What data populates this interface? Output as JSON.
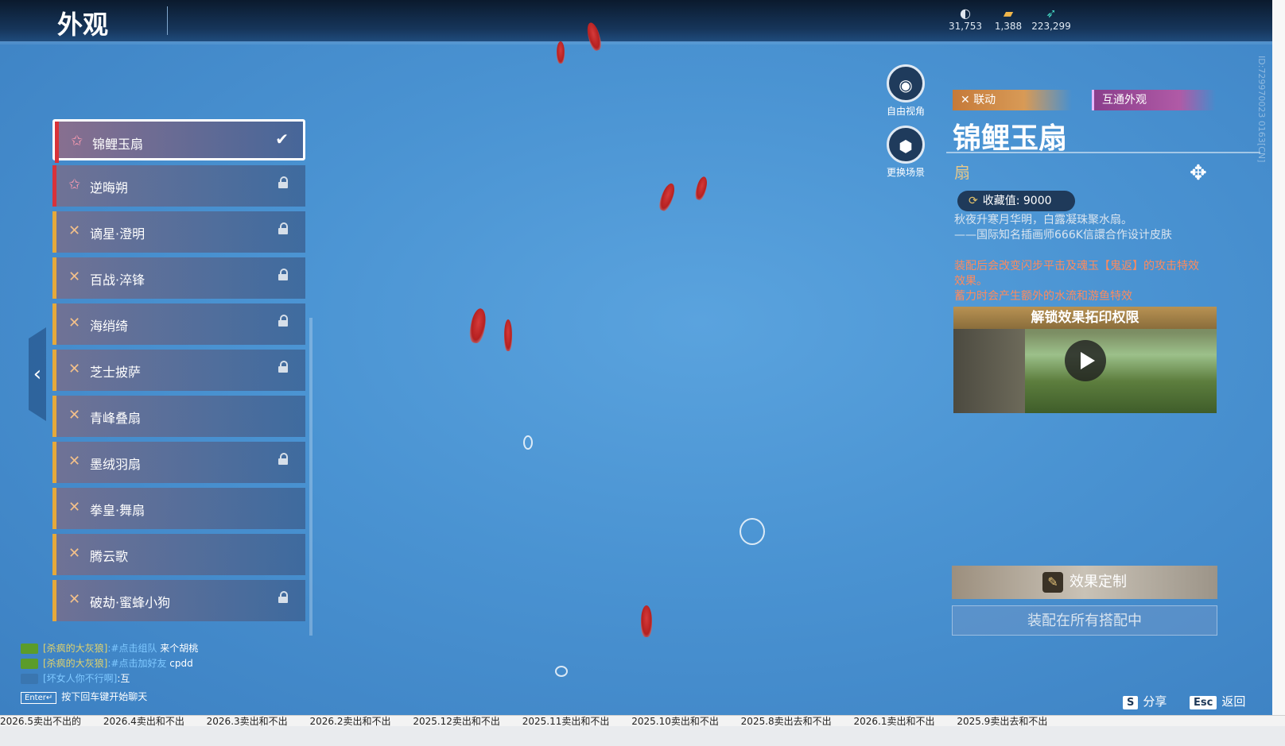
{
  "header": {
    "title": "外观"
  },
  "currencies": [
    {
      "icon": "crystal-icon",
      "value": "31,753"
    },
    {
      "icon": "gold-ticket-icon",
      "value": "1,388"
    },
    {
      "icon": "feather-icon",
      "value": "223,299"
    }
  ],
  "skins": [
    {
      "label": "锦鲤玉扇",
      "rarity": "red",
      "state": "selected"
    },
    {
      "label": "逆晦朔",
      "rarity": "red",
      "state": "locked"
    },
    {
      "label": "谪星·澄明",
      "rarity": "gold",
      "state": "locked"
    },
    {
      "label": "百战·淬锋",
      "rarity": "gold",
      "state": "locked"
    },
    {
      "label": "海绡绮",
      "rarity": "gold",
      "state": "locked"
    },
    {
      "label": "芝士披萨",
      "rarity": "gold",
      "state": "locked"
    },
    {
      "label": "青峰叠扇",
      "rarity": "gold",
      "state": "owned"
    },
    {
      "label": "墨绒羽扇",
      "rarity": "gold",
      "state": "locked"
    },
    {
      "label": "拳皇·舞扇",
      "rarity": "gold",
      "state": "owned"
    },
    {
      "label": "腾云歌",
      "rarity": "gold",
      "state": "owned"
    },
    {
      "label": "破劫·蜜蜂小狗",
      "rarity": "gold",
      "state": "locked"
    }
  ],
  "camera": {
    "free_view": "自由视角",
    "change_scene": "更换场景"
  },
  "detail": {
    "badge_collab": "联动",
    "badge_shared": "互通外观",
    "name": "锦鲤玉扇",
    "type": "扇",
    "collect_label": "收藏值: 9000",
    "desc_line1": "秋夜升寒月华明，白露凝珠聚水扇。",
    "desc_line2": "——国际知名插画师666K信譞合作设计皮肤",
    "effect_line1": "装配后会改变闪步平击及魂玉【鬼返】的攻击特效",
    "effect_line2": "效果。",
    "effect_line3": "蓄力时会产生额外的水流和游鱼特效",
    "video_title": "解锁效果拓印权限",
    "customize": "效果定制",
    "equip_all": "装配在所有搭配中",
    "id_text": "ID:729970023 0163[CN]"
  },
  "chat": {
    "line1_name": "[杀疯的大灰狼]",
    "line1_sys": ":#点击组队",
    "line1_text": " 来个胡桃",
    "line2_name": "[杀疯的大灰狼]",
    "line2_sys": ":#点击加好友",
    "line2_text": " cpdd",
    "line3_name": "[坏女人你不行啊]",
    "line3_text": ":互",
    "enter_key": "Enter↵",
    "enter_hint": "按下回车键开始聊天"
  },
  "hints": {
    "share_key": "S",
    "share": "分享",
    "back_key": "Esc",
    "back": "返回"
  },
  "browser_tabs": [
    "2026.5卖出不出的",
    "2026.4卖出和不出",
    "2026.3卖出和不出",
    "2026.2卖出和不出",
    "2025.12卖出和不出",
    "2025.11卖出和不出",
    "2025.10卖出和不出",
    "2025.8卖出去和不出",
    "2026.1卖出和不出",
    "2025.9卖出去和不出"
  ],
  "colors": {
    "accent_gold": "#e6a93a",
    "accent_red": "#d8323a",
    "effect_text": "#ff8a5c"
  }
}
